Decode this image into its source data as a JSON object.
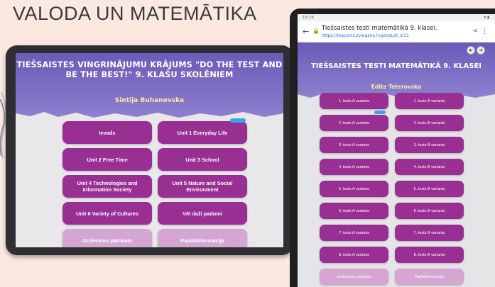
{
  "headline": "VALODA UN MATEMĀTIKA",
  "left_app": {
    "title": "TIEŠSAISTES VINGRINĀJUMU KRĀJUMS \"DO THE TEST AND BE THE BEST!\" 9. KLAŠU SKOLĒNIEM",
    "author": "Sintija Buhanovska",
    "buttons": [
      {
        "label": "Ievads"
      },
      {
        "label": "Unit 1 Everyday Life"
      },
      {
        "label": "Unit 2 Free Time"
      },
      {
        "label": "Unit 3 School"
      },
      {
        "label": "Unit 4 Technologies and Information Society"
      },
      {
        "label": "Unit 5 Nature and Social Environment"
      },
      {
        "label": "Unit 6 Variety of Cultures"
      },
      {
        "label": "Vēl daži padomi"
      },
      {
        "label": "Uzdevumu pārskats"
      },
      {
        "label": "Papildinformācija"
      }
    ]
  },
  "right_app": {
    "status_time": "15:16",
    "page_title": "Tiešsaistes testi matemātikā 9. klasei.",
    "url": "https://maconis.zvaigzne.lv/product_s/11",
    "title": "TIEŠSAISTES TESTI MATEMĀTIKĀ 9. KLASEI",
    "author": "Edīte Teterovska",
    "buttons": [
      {
        "label": "1. tests A variants"
      },
      {
        "label": "1. tests B variants"
      },
      {
        "label": "2. tests A variants"
      },
      {
        "label": "2. tests B variants"
      },
      {
        "label": "3. tests A variants"
      },
      {
        "label": "3. tests B variants"
      },
      {
        "label": "4. tests A variants"
      },
      {
        "label": "4. tests B variants"
      },
      {
        "label": "5. tests A variants"
      },
      {
        "label": "5. tests B variants"
      },
      {
        "label": "6. tests A variants"
      },
      {
        "label": "6. tests B variants"
      },
      {
        "label": "7. tests A variants"
      },
      {
        "label": "7. tests B variants"
      },
      {
        "label": "8. tests A variants"
      },
      {
        "label": "8. tests B variants"
      },
      {
        "label": "Uzdevumu pārskats"
      },
      {
        "label": "Papildinformācija"
      }
    ]
  },
  "colors": {
    "button": "#9a2f93",
    "button_light": "#d5a6d1",
    "hero_top": "#6c5bb9",
    "author": "#ffe9a6",
    "background": "#fbe8e1"
  }
}
